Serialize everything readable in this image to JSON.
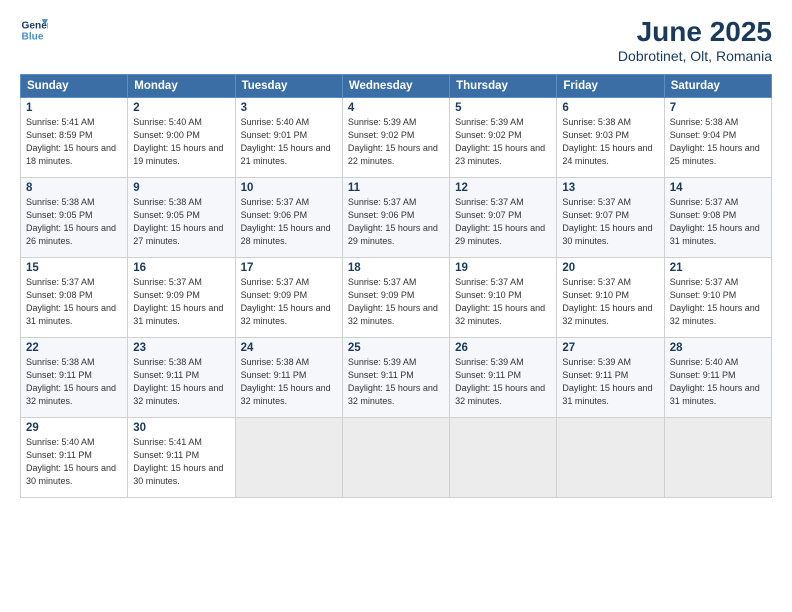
{
  "logo": {
    "line1": "General",
    "line2": "Blue"
  },
  "title": "June 2025",
  "subtitle": "Dobrotinet, Olt, Romania",
  "days_of_week": [
    "Sunday",
    "Monday",
    "Tuesday",
    "Wednesday",
    "Thursday",
    "Friday",
    "Saturday"
  ],
  "weeks": [
    [
      {
        "day": 1,
        "rise": "5:41 AM",
        "set": "8:59 PM",
        "daylight": "15 hours and 18 minutes."
      },
      {
        "day": 2,
        "rise": "5:40 AM",
        "set": "9:00 PM",
        "daylight": "15 hours and 19 minutes."
      },
      {
        "day": 3,
        "rise": "5:40 AM",
        "set": "9:01 PM",
        "daylight": "15 hours and 21 minutes."
      },
      {
        "day": 4,
        "rise": "5:39 AM",
        "set": "9:02 PM",
        "daylight": "15 hours and 22 minutes."
      },
      {
        "day": 5,
        "rise": "5:39 AM",
        "set": "9:02 PM",
        "daylight": "15 hours and 23 minutes."
      },
      {
        "day": 6,
        "rise": "5:38 AM",
        "set": "9:03 PM",
        "daylight": "15 hours and 24 minutes."
      },
      {
        "day": 7,
        "rise": "5:38 AM",
        "set": "9:04 PM",
        "daylight": "15 hours and 25 minutes."
      }
    ],
    [
      {
        "day": 8,
        "rise": "5:38 AM",
        "set": "9:05 PM",
        "daylight": "15 hours and 26 minutes."
      },
      {
        "day": 9,
        "rise": "5:38 AM",
        "set": "9:05 PM",
        "daylight": "15 hours and 27 minutes."
      },
      {
        "day": 10,
        "rise": "5:37 AM",
        "set": "9:06 PM",
        "daylight": "15 hours and 28 minutes."
      },
      {
        "day": 11,
        "rise": "5:37 AM",
        "set": "9:06 PM",
        "daylight": "15 hours and 29 minutes."
      },
      {
        "day": 12,
        "rise": "5:37 AM",
        "set": "9:07 PM",
        "daylight": "15 hours and 29 minutes."
      },
      {
        "day": 13,
        "rise": "5:37 AM",
        "set": "9:07 PM",
        "daylight": "15 hours and 30 minutes."
      },
      {
        "day": 14,
        "rise": "5:37 AM",
        "set": "9:08 PM",
        "daylight": "15 hours and 31 minutes."
      }
    ],
    [
      {
        "day": 15,
        "rise": "5:37 AM",
        "set": "9:08 PM",
        "daylight": "15 hours and 31 minutes."
      },
      {
        "day": 16,
        "rise": "5:37 AM",
        "set": "9:09 PM",
        "daylight": "15 hours and 31 minutes."
      },
      {
        "day": 17,
        "rise": "5:37 AM",
        "set": "9:09 PM",
        "daylight": "15 hours and 32 minutes."
      },
      {
        "day": 18,
        "rise": "5:37 AM",
        "set": "9:09 PM",
        "daylight": "15 hours and 32 minutes."
      },
      {
        "day": 19,
        "rise": "5:37 AM",
        "set": "9:10 PM",
        "daylight": "15 hours and 32 minutes."
      },
      {
        "day": 20,
        "rise": "5:37 AM",
        "set": "9:10 PM",
        "daylight": "15 hours and 32 minutes."
      },
      {
        "day": 21,
        "rise": "5:37 AM",
        "set": "9:10 PM",
        "daylight": "15 hours and 32 minutes."
      }
    ],
    [
      {
        "day": 22,
        "rise": "5:38 AM",
        "set": "9:11 PM",
        "daylight": "15 hours and 32 minutes."
      },
      {
        "day": 23,
        "rise": "5:38 AM",
        "set": "9:11 PM",
        "daylight": "15 hours and 32 minutes."
      },
      {
        "day": 24,
        "rise": "5:38 AM",
        "set": "9:11 PM",
        "daylight": "15 hours and 32 minutes."
      },
      {
        "day": 25,
        "rise": "5:39 AM",
        "set": "9:11 PM",
        "daylight": "15 hours and 32 minutes."
      },
      {
        "day": 26,
        "rise": "5:39 AM",
        "set": "9:11 PM",
        "daylight": "15 hours and 32 minutes."
      },
      {
        "day": 27,
        "rise": "5:39 AM",
        "set": "9:11 PM",
        "daylight": "15 hours and 31 minutes."
      },
      {
        "day": 28,
        "rise": "5:40 AM",
        "set": "9:11 PM",
        "daylight": "15 hours and 31 minutes."
      }
    ],
    [
      {
        "day": 29,
        "rise": "5:40 AM",
        "set": "9:11 PM",
        "daylight": "15 hours and 30 minutes."
      },
      {
        "day": 30,
        "rise": "5:41 AM",
        "set": "9:11 PM",
        "daylight": "15 hours and 30 minutes."
      },
      null,
      null,
      null,
      null,
      null
    ]
  ]
}
